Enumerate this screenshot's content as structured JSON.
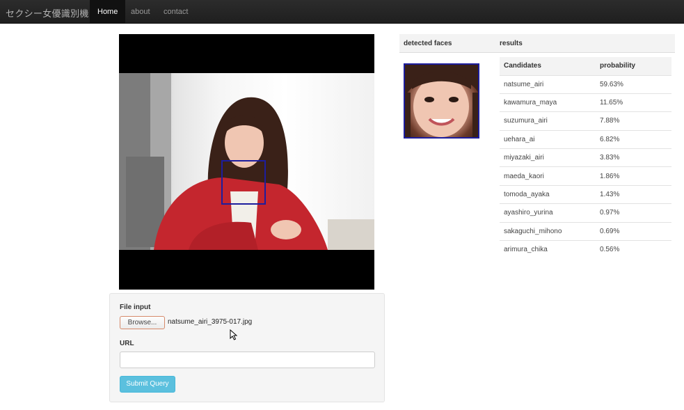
{
  "navbar": {
    "brand": "セクシー女優識別機",
    "items": [
      {
        "label": "Home",
        "active": true
      },
      {
        "label": "about",
        "active": false
      },
      {
        "label": "contact",
        "active": false
      }
    ]
  },
  "form": {
    "file_label": "File input",
    "browse_label": "Browse...",
    "file_name": "natsume_airi_3975-017.jpg",
    "url_label": "URL",
    "url_value": "",
    "submit_label": "Submit Query"
  },
  "results": {
    "detected_faces_label": "detected faces",
    "results_label": "results",
    "columns": [
      "Candidates",
      "probability"
    ],
    "rows": [
      [
        "natsume_airi",
        "59.63%"
      ],
      [
        "kawamura_maya",
        "11.65%"
      ],
      [
        "suzumura_airi",
        "7.88%"
      ],
      [
        "uehara_ai",
        "6.82%"
      ],
      [
        "miyazaki_airi",
        "3.83%"
      ],
      [
        "maeda_kaori",
        "1.86%"
      ],
      [
        "tomoda_ayaka",
        "1.43%"
      ],
      [
        "ayashiro_yurina",
        "0.97%"
      ],
      [
        "sakaguchi_mihono",
        "0.69%"
      ],
      [
        "arimura_chika",
        "0.56%"
      ]
    ]
  },
  "colors": {
    "navbar_bg": "#222222",
    "face_box": "#1d1d9e",
    "submit_bg": "#5bc0de"
  }
}
